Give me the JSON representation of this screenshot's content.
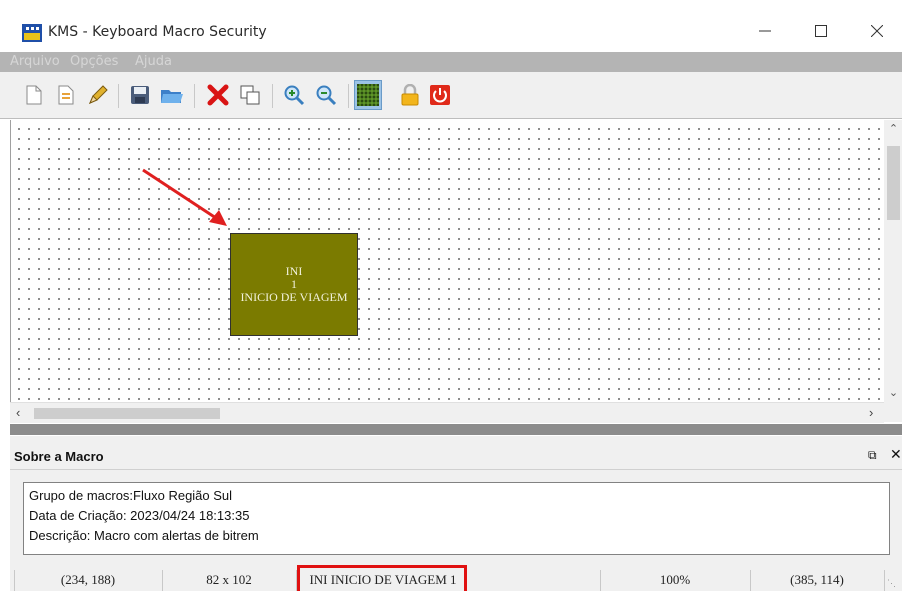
{
  "window": {
    "title": "KMS - Keyboard Macro Security",
    "controls": [
      "minimize",
      "maximize",
      "close"
    ]
  },
  "menu": {
    "items": [
      "Arquivo",
      "Opções",
      "Ajuda"
    ]
  },
  "toolbar": {
    "buttons": [
      "new-document-icon",
      "open-document-icon",
      "pencil-icon",
      "save-icon",
      "open-folder-icon",
      "delete-icon",
      "copy-icon",
      "zoom-in-icon",
      "zoom-out-icon",
      "grid-icon",
      "lock-icon",
      "power-icon"
    ],
    "active": "grid-icon"
  },
  "canvas": {
    "macro": {
      "line1": "INI",
      "line2": "1",
      "line3": "INICIO DE VIAGEM",
      "fill_color": "#7b7b00"
    },
    "annotation_arrow_color": "#e02020"
  },
  "panel": {
    "title": "Sobre a Macro",
    "group": "Grupo de macros:Fluxo Região Sul",
    "created": "Data de Criação: 2023/04/24 18:13:35",
    "description": "Descrição: Macro com alertas de bitrem"
  },
  "status": {
    "position": "(234, 188)",
    "size": "82 x 102",
    "selected": "INI INICIO DE VIAGEM 1",
    "zoom": "100%",
    "cursor": "(385, 114)",
    "highlight_color": "#e01010"
  }
}
